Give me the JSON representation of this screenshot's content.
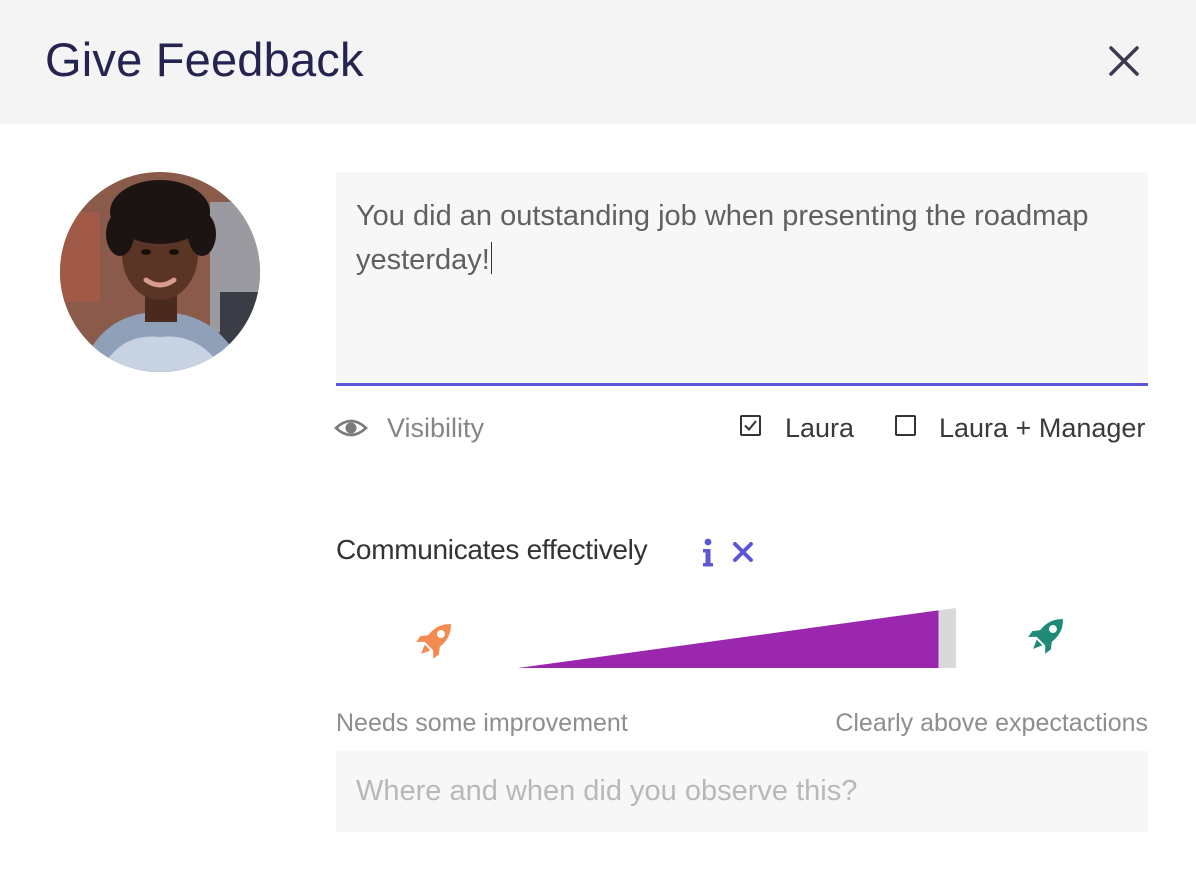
{
  "header": {
    "title": "Give Feedback",
    "close_icon": "close-icon"
  },
  "recipient": {
    "avatar_icon": "avatar-photo"
  },
  "feedback": {
    "text": "You did an outstanding job when presenting the roadmap yesterday!",
    "accent_color": "#5b57d6"
  },
  "visibility": {
    "label": "Visibility",
    "icon": "eye-icon",
    "options": [
      {
        "label": "Laura",
        "checked": true
      },
      {
        "label": "Laura + Manager",
        "checked": false
      }
    ]
  },
  "competency": {
    "name": "Communicates effectively",
    "info_icon": "info-icon",
    "remove_icon": "remove-icon",
    "rating": 0.96,
    "slider_color": "#9b27af",
    "low_label": "Needs some improvement",
    "high_label": "Clearly above expectactions",
    "low_icon": "rocket-orange-icon",
    "high_icon": "rocket-green-icon"
  },
  "observation": {
    "placeholder": "Where and when did you observe this?"
  }
}
